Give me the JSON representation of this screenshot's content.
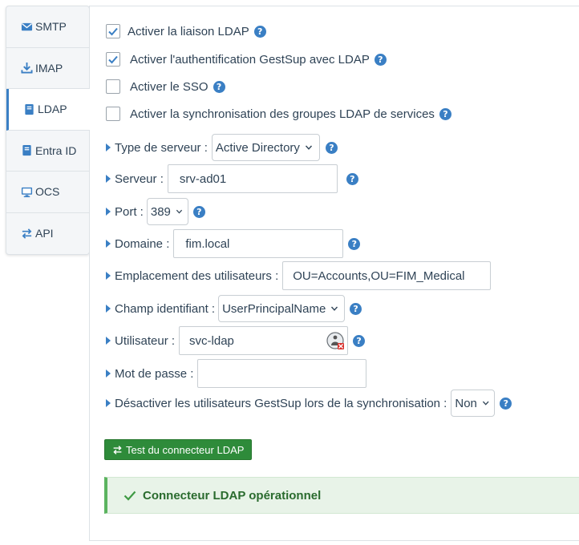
{
  "tabs": [
    {
      "label": "SMTP",
      "icon": "envelope-icon"
    },
    {
      "label": "IMAP",
      "icon": "download-icon"
    },
    {
      "label": "LDAP",
      "icon": "book-icon"
    },
    {
      "label": "Entra ID",
      "icon": "book-icon"
    },
    {
      "label": "OCS",
      "icon": "monitor-icon"
    },
    {
      "label": "API",
      "icon": "exchange-icon"
    }
  ],
  "active_tab": "LDAP",
  "checkboxes": {
    "ldap_link": {
      "label": "Activer la liaison LDAP",
      "checked": true
    },
    "ldap_auth": {
      "label": "Activer l'authentification GestSup avec LDAP",
      "checked": true
    },
    "sso": {
      "label": "Activer le SSO",
      "checked": false
    },
    "group_sync": {
      "label": "Activer la synchronisation des groupes LDAP de services",
      "checked": false
    }
  },
  "fields": {
    "server_type": {
      "label": "Type de serveur :",
      "value": "Active Directory"
    },
    "server": {
      "label": "Serveur :",
      "value": "srv-ad01"
    },
    "port": {
      "label": "Port :",
      "value": "389"
    },
    "domain": {
      "label": "Domaine :",
      "value": "fim.local"
    },
    "user_location": {
      "label": "Emplacement des utilisateurs :",
      "value": "OU=Accounts,OU=FIM_Medical"
    },
    "id_field": {
      "label": "Champ identifiant :",
      "value": "UserPrincipalName"
    },
    "user": {
      "label": "Utilisateur :",
      "value": "svc-ldap"
    },
    "password": {
      "label": "Mot de passe :",
      "value": ""
    },
    "disable_users": {
      "label": "Désactiver les utilisateurs GestSup lors de la synchronisation :",
      "value": "Non"
    }
  },
  "help_label": "?",
  "test_button": {
    "label": "Test du connecteur LDAP"
  },
  "alert": {
    "message": "Connecteur LDAP opérationnel"
  },
  "colors": {
    "accent": "#3a7fc4",
    "success": "#2e8b3a",
    "alert_bg": "#e8f3e8"
  }
}
